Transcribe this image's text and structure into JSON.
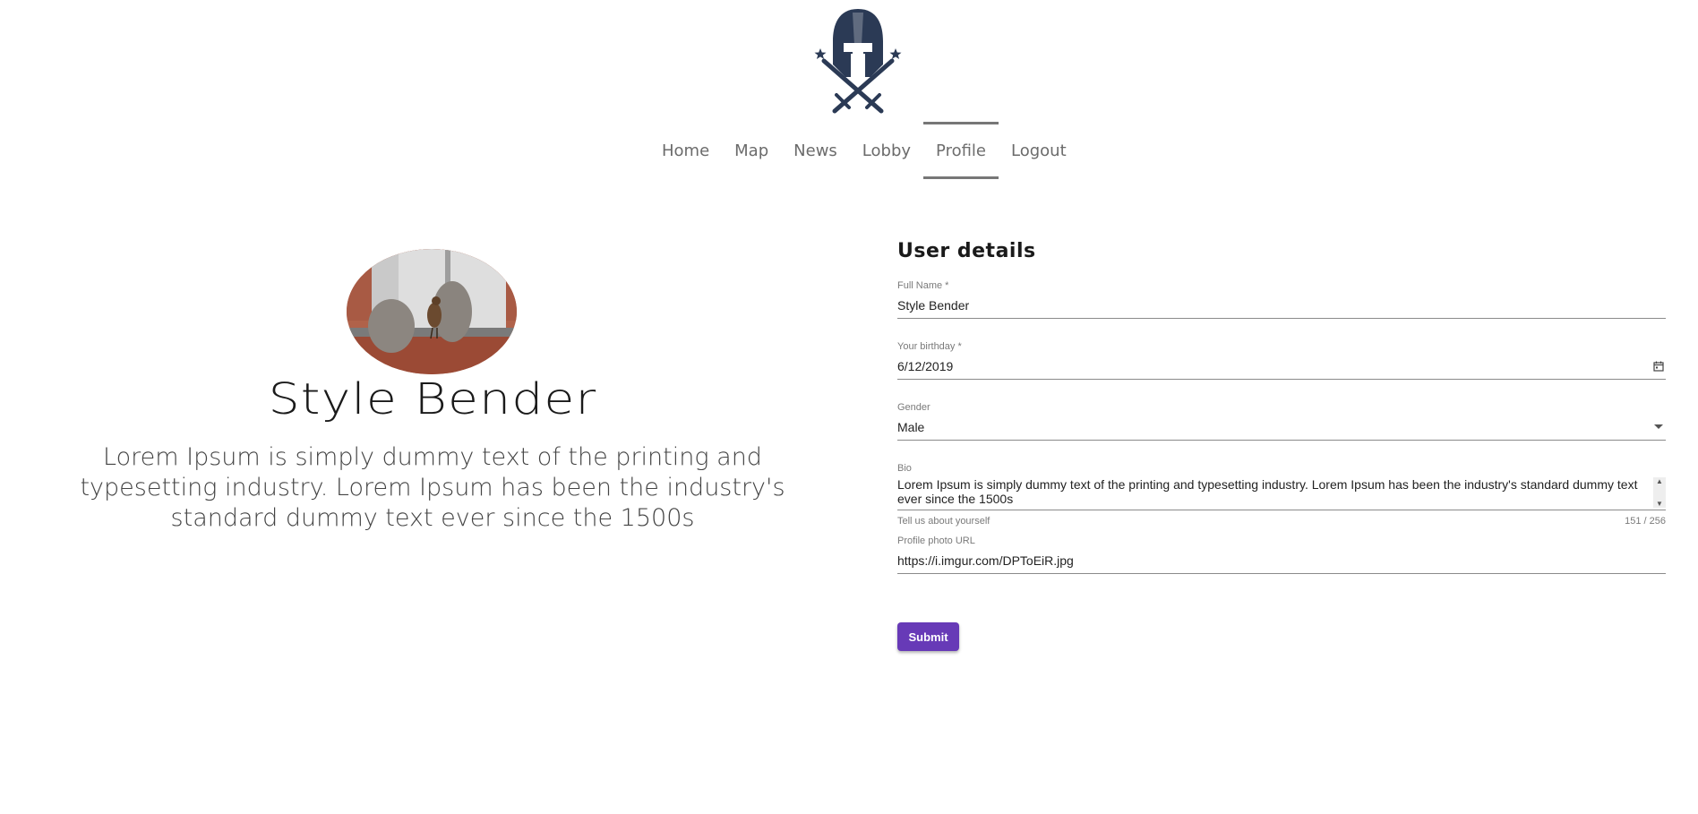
{
  "header": {
    "logo_icon": "spartan-helmet-crossed-swords-logo",
    "nav": [
      {
        "label": "Home"
      },
      {
        "label": "Map"
      },
      {
        "label": "News"
      },
      {
        "label": "Lobby"
      },
      {
        "label": "Profile",
        "active": true
      },
      {
        "label": "Logout"
      }
    ]
  },
  "profile": {
    "avatar_icon": "bird-photo-avatar",
    "name": "Style Bender",
    "bio": "Lorem Ipsum is simply dummy text of the printing and typesetting industry. Lorem Ipsum has been the industry's standard dummy text ever since the 1500s"
  },
  "form": {
    "title": "User details",
    "full_name": {
      "label": "Full Name *",
      "value": "Style Bender"
    },
    "birthday": {
      "label": "Your birthday *",
      "value": "6/12/2019",
      "icon": "calendar-icon"
    },
    "gender": {
      "label": "Gender",
      "value": "Male",
      "icon": "dropdown-arrow-icon"
    },
    "bio": {
      "label": "Bio",
      "value": "Lorem Ipsum is simply dummy text of the printing and typesetting industry. Lorem Ipsum has been the industry's standard dummy text ever since the 1500s",
      "hint": "Tell us about yourself",
      "counter": "151 / 256"
    },
    "photo_url": {
      "label": "Profile photo URL",
      "value": "https://i.imgur.com/DPToEiR.jpg"
    },
    "submit_label": "Submit"
  },
  "colors": {
    "accent": "#673ab7",
    "logo": "#2b3a55"
  }
}
